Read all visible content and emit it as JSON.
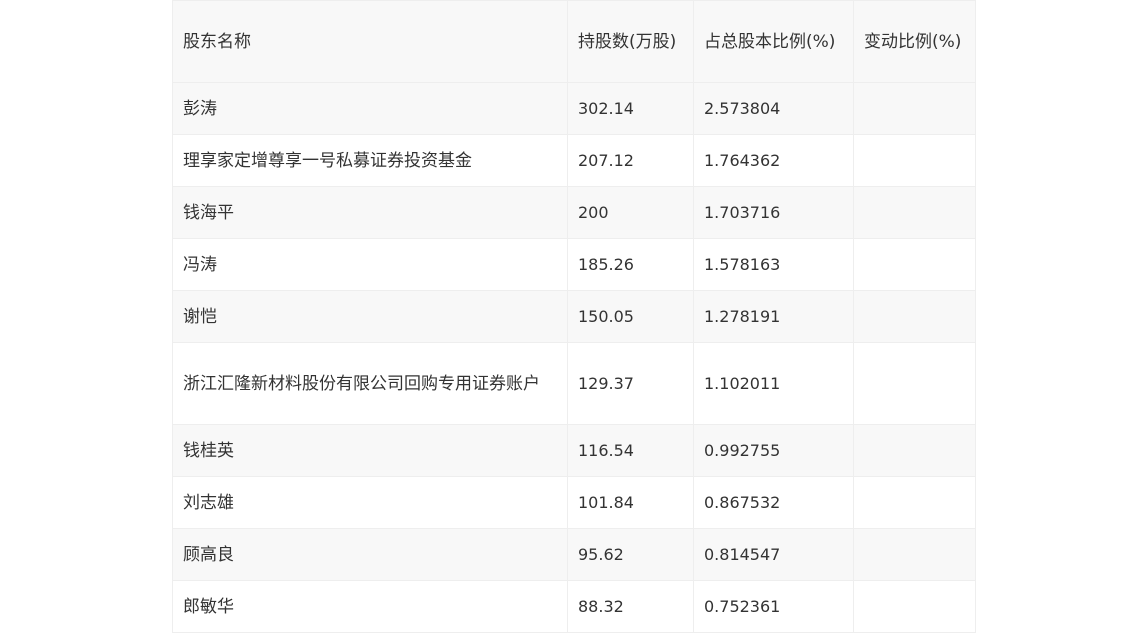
{
  "table": {
    "headers": [
      "股东名称",
      "持股数(万股)",
      "占总股本比例(%)",
      "变动比例(%)"
    ],
    "rows": [
      {
        "name": "彭涛",
        "shares": "302.14",
        "ratio": "2.573804",
        "change": ""
      },
      {
        "name": "理享家定增尊享一号私募证券投资基金",
        "shares": "207.12",
        "ratio": "1.764362",
        "change": ""
      },
      {
        "name": "钱海平",
        "shares": "200",
        "ratio": "1.703716",
        "change": ""
      },
      {
        "name": "冯涛",
        "shares": "185.26",
        "ratio": "1.578163",
        "change": ""
      },
      {
        "name": "谢恺",
        "shares": "150.05",
        "ratio": "1.278191",
        "change": ""
      },
      {
        "name": "浙江汇隆新材料股份有限公司回购专用证券账户",
        "shares": "129.37",
        "ratio": "1.102011",
        "change": ""
      },
      {
        "name": "钱桂英",
        "shares": "116.54",
        "ratio": "0.992755",
        "change": ""
      },
      {
        "name": "刘志雄",
        "shares": "101.84",
        "ratio": "0.867532",
        "change": ""
      },
      {
        "name": "顾高良",
        "shares": "95.62",
        "ratio": "0.814547",
        "change": ""
      },
      {
        "name": "郎敏华",
        "shares": "88.32",
        "ratio": "0.752361",
        "change": ""
      }
    ]
  }
}
